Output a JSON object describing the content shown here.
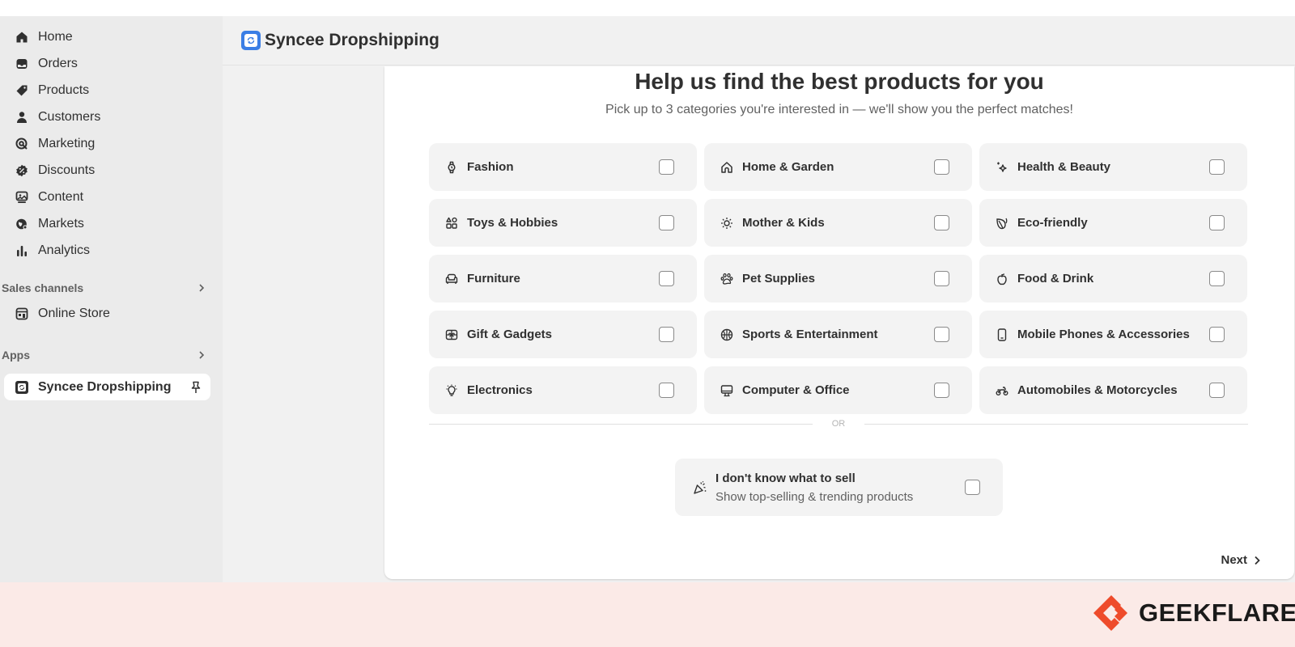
{
  "sidebar": {
    "items": [
      {
        "label": "Home",
        "icon": "home-icon"
      },
      {
        "label": "Orders",
        "icon": "inbox-icon"
      },
      {
        "label": "Products",
        "icon": "tag-icon"
      },
      {
        "label": "Customers",
        "icon": "person-icon"
      },
      {
        "label": "Marketing",
        "icon": "target-icon"
      },
      {
        "label": "Discounts",
        "icon": "discount-icon"
      },
      {
        "label": "Content",
        "icon": "image-icon"
      },
      {
        "label": "Markets",
        "icon": "globe-icon"
      },
      {
        "label": "Analytics",
        "icon": "bar-chart-icon"
      }
    ],
    "sales_channels_label": "Sales channels",
    "online_store_label": "Online Store",
    "apps_label": "Apps",
    "app_item_label": "Syncee Dropshipping"
  },
  "header": {
    "title": "Syncee Dropshipping"
  },
  "card": {
    "title": "Help us find the best products for you",
    "subtitle": "Pick up to 3 categories you're interested in — we'll show you the perfect matches!",
    "categories": [
      {
        "label": "Fashion",
        "icon": "watch-icon"
      },
      {
        "label": "Home & Garden",
        "icon": "house-icon"
      },
      {
        "label": "Health & Beauty",
        "icon": "sparkle-icon"
      },
      {
        "label": "Toys & Hobbies",
        "icon": "shapes-icon"
      },
      {
        "label": "Mother & Kids",
        "icon": "sun-icon"
      },
      {
        "label": "Eco-friendly",
        "icon": "leaf-icon"
      },
      {
        "label": "Furniture",
        "icon": "sofa-icon"
      },
      {
        "label": "Pet Supplies",
        "icon": "paw-icon"
      },
      {
        "label": "Food & Drink",
        "icon": "apple-icon"
      },
      {
        "label": "Gift & Gadgets",
        "icon": "gift-icon"
      },
      {
        "label": "Sports & Entertainment",
        "icon": "ball-icon"
      },
      {
        "label": "Mobile Phones & Accessories",
        "icon": "phone-icon"
      },
      {
        "label": "Electronics",
        "icon": "bulb-icon"
      },
      {
        "label": "Computer & Office",
        "icon": "monitor-icon"
      },
      {
        "label": "Automobiles & Motorcycles",
        "icon": "motorcycle-icon"
      }
    ],
    "or_label": "OR",
    "idk_title": "I don't know what to sell",
    "idk_subtitle": "Show top-selling & trending products",
    "next_label": "Next"
  },
  "brand": {
    "name": "GEEKFLARE",
    "color": "#ee4b2b"
  }
}
